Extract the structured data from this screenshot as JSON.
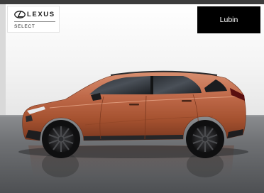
{
  "brand": {
    "wordmark": "LEXUS",
    "sub_label": "SELECT",
    "logo_icon": "lexus-emblem-icon"
  },
  "dealer": {
    "location_label": "Lubin"
  },
  "vehicle": {
    "body_color": "#b55a3c",
    "wheel_color": "#1b1b1d",
    "photo_alt": "copper compact SUV side profile"
  },
  "colors": {
    "button_bg": "#000000",
    "button_text": "#ffffff",
    "backdrop_top": "#ffffff",
    "floor": "#6e7073"
  }
}
